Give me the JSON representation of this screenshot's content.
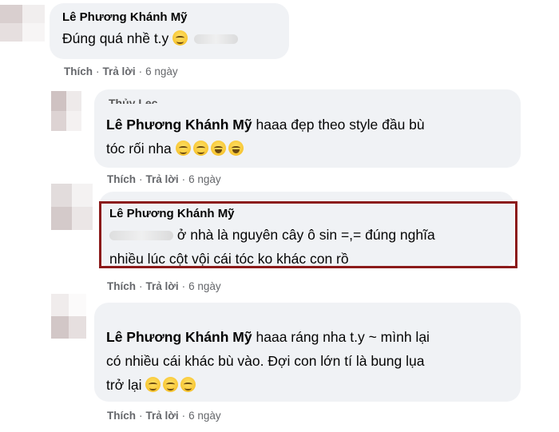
{
  "comments": [
    {
      "author": "Lê Phương Khánh Mỹ",
      "text": "Đúng quá nhề t.y",
      "actions": {
        "like": "Thích",
        "reply": "Trả lời",
        "time": "6 ngày"
      }
    },
    {
      "cut_header": "Thủy Lec",
      "mention": "Lê Phương Khánh Mỹ",
      "line1": "haaa đẹp theo style đầu bù",
      "line2": "tóc rối nha",
      "actions": {
        "like": "Thích",
        "reply": "Trả lời",
        "time": "6 ngày"
      }
    },
    {
      "author": "Lê Phương Khánh Mỹ",
      "line1": "ở nhà là nguyên cây ô sin =,= đúng nghĩa",
      "line2": "nhiều lúc cột vội cái tóc ko khác con rồ",
      "actions": {
        "like": "Thích",
        "reply": "Trả lời",
        "time": "6 ngày"
      }
    },
    {
      "mention": "Lê Phương Khánh Mỹ",
      "line1": "haaa ráng nha t.y ~ mình lại",
      "line2": "có nhiều cái khác bù vào. Đợi con lớn tí là bung lụa",
      "line3": "trở lại",
      "actions": {
        "like": "Thích",
        "reply": "Trả lời",
        "time": "6 ngày"
      }
    }
  ],
  "colors": {
    "bubble": "#f0f2f5",
    "action_text": "#65676b",
    "highlight_border": "#8b1a1a"
  },
  "icons": [
    "smiling-emoji-icon",
    "laughing-tears-emoji-icon"
  ]
}
